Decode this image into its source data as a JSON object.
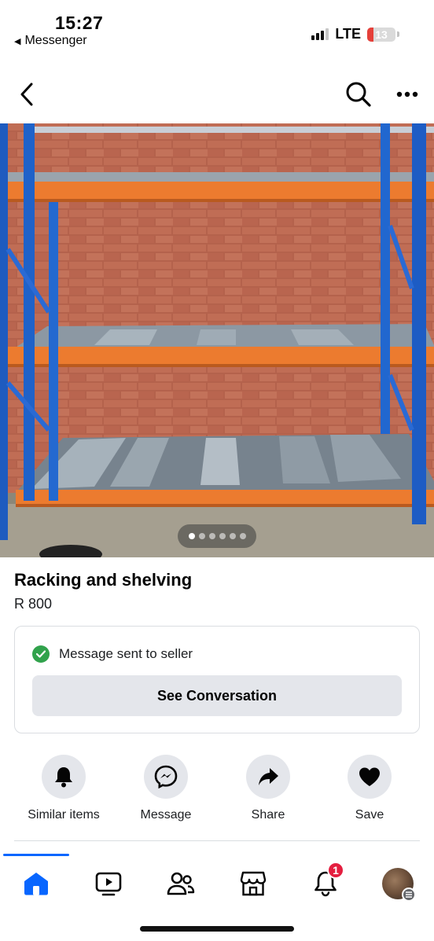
{
  "status_bar": {
    "time": "15:27",
    "back_app": "Messenger",
    "network": "LTE",
    "battery": "13"
  },
  "nav": {
    "back_icon": "chevron-left-icon",
    "search_icon": "search-icon",
    "more_icon": "more-horizontal-icon"
  },
  "photo": {
    "page_count": 6,
    "current_page": 1
  },
  "listing": {
    "title": "Racking and shelving",
    "price": "R 800"
  },
  "message_card": {
    "status": "Message sent to seller",
    "button": "See Conversation"
  },
  "actions": [
    {
      "label": "Similar items",
      "icon": "bell-icon"
    },
    {
      "label": "Message",
      "icon": "messenger-icon"
    },
    {
      "label": "Share",
      "icon": "share-arrow-icon"
    },
    {
      "label": "Save",
      "icon": "heart-icon"
    }
  ],
  "tabs": [
    {
      "name": "home",
      "icon": "home-icon",
      "active": true
    },
    {
      "name": "video",
      "icon": "video-icon"
    },
    {
      "name": "friends",
      "icon": "friends-icon"
    },
    {
      "name": "marketplace",
      "icon": "marketplace-icon"
    },
    {
      "name": "notifications",
      "icon": "bell-icon",
      "badge": "1"
    },
    {
      "name": "profile",
      "icon": "avatar-icon"
    }
  ],
  "colors": {
    "accent": "#0866ff",
    "success": "#31a24c",
    "badge": "#e41e3f",
    "button_bg": "#e4e6eb"
  }
}
